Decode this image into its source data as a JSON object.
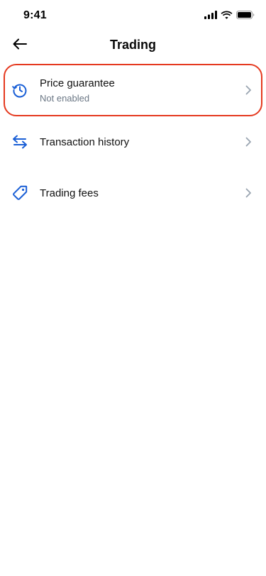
{
  "status_bar": {
    "time": "9:41",
    "signal_icon": "cellular-signal-icon",
    "wifi_icon": "wifi-icon",
    "battery_icon": "battery-icon"
  },
  "header": {
    "back_icon": "arrow-left-icon",
    "title": "Trading"
  },
  "menu": {
    "items": [
      {
        "icon": "clock-refresh-icon",
        "label": "Price guarantee",
        "sublabel": "Not enabled",
        "highlighted": true
      },
      {
        "icon": "swap-arrows-icon",
        "label": "Transaction history"
      },
      {
        "icon": "tag-icon",
        "label": "Trading fees"
      }
    ]
  },
  "colors": {
    "accent": "#1a5fd6",
    "highlight_border": "#e5391f",
    "subtext": "#6b7785",
    "chevron": "#9aa5b1"
  }
}
